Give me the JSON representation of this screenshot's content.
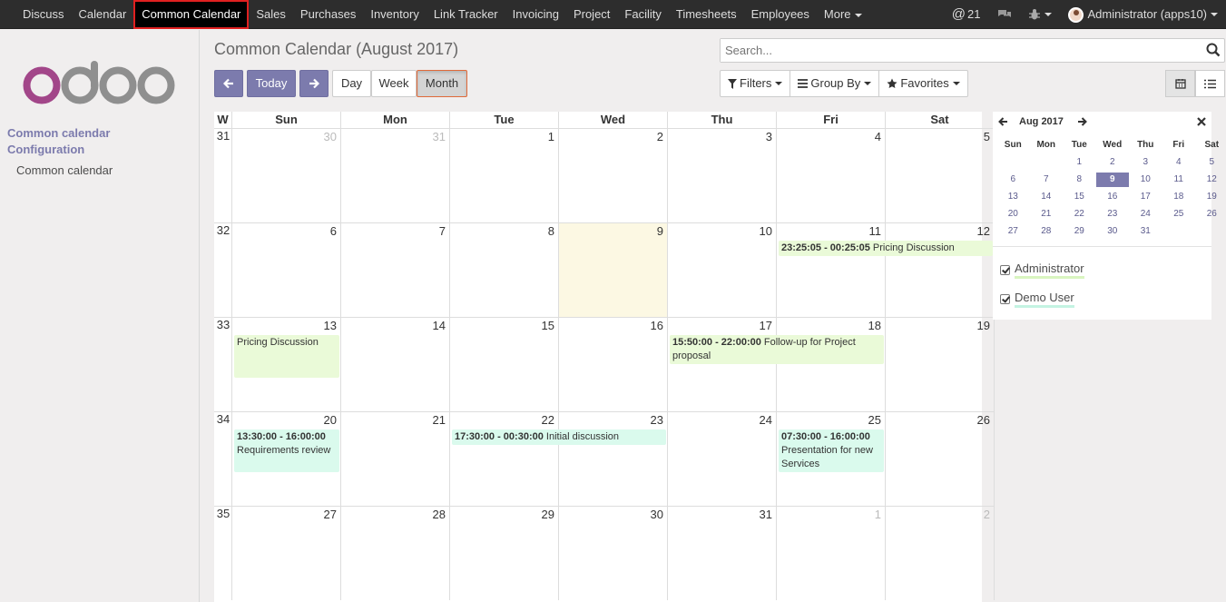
{
  "nav": {
    "menu": [
      "Discuss",
      "Calendar",
      "Common Calendar",
      "Sales",
      "Purchases",
      "Inventory",
      "Link Tracker",
      "Invoicing",
      "Project",
      "Facility",
      "Timesheets",
      "Employees",
      "More"
    ],
    "active": "Common Calendar",
    "mentions_count": "21",
    "user": "Administrator (apps10)"
  },
  "sidebar": {
    "section": "Common calendar Configuration",
    "items": [
      "Common calendar"
    ]
  },
  "header": {
    "title": "Common Calendar (August 2017)",
    "today_label": "Today",
    "views": [
      "Day",
      "Week",
      "Month"
    ],
    "active_view": "Month",
    "search_placeholder": "Search...",
    "filters_label": "Filters",
    "groupby_label": "Group By",
    "favorites_label": "Favorites"
  },
  "calendar": {
    "week_header": "W",
    "day_headers": [
      "Sun",
      "Mon",
      "Tue",
      "Wed",
      "Thu",
      "Fri",
      "Sat"
    ],
    "weeks": [
      {
        "num": "31",
        "days": [
          "30",
          "31",
          "1",
          "2",
          "3",
          "4",
          "5"
        ],
        "other": [
          true,
          true,
          false,
          false,
          false,
          false,
          false
        ]
      },
      {
        "num": "32",
        "days": [
          "6",
          "7",
          "8",
          "9",
          "10",
          "11",
          "12"
        ],
        "other": [
          false,
          false,
          false,
          false,
          false,
          false,
          false
        ]
      },
      {
        "num": "33",
        "days": [
          "13",
          "14",
          "15",
          "16",
          "17",
          "18",
          "19"
        ],
        "other": [
          false,
          false,
          false,
          false,
          false,
          false,
          false
        ]
      },
      {
        "num": "34",
        "days": [
          "20",
          "21",
          "22",
          "23",
          "24",
          "25",
          "26"
        ],
        "other": [
          false,
          false,
          false,
          false,
          false,
          false,
          false
        ]
      },
      {
        "num": "35",
        "days": [
          "27",
          "28",
          "29",
          "30",
          "31",
          "1",
          "2"
        ],
        "other": [
          false,
          false,
          false,
          false,
          false,
          true,
          true
        ]
      }
    ],
    "today": "9",
    "events": [
      {
        "time": "23:25:05 - 00:25:05",
        "title": "Pricing Discussion",
        "week": 1,
        "start": 5,
        "span": 2,
        "color": "green"
      },
      {
        "time": "",
        "title": "Pricing Discussion",
        "week": 2,
        "start": 0,
        "span": 1,
        "color": "green"
      },
      {
        "time": "15:50:00 - 22:00:00",
        "title": "Follow-up for Project proposal",
        "week": 2,
        "start": 4,
        "span": 2,
        "color": "green"
      },
      {
        "time": "13:30:00 - 16:00:00",
        "title": "Requirements review",
        "week": 3,
        "start": 0,
        "span": 1,
        "color": "teal"
      },
      {
        "time": "17:30:00 - 00:30:00",
        "title": "Initial discussion",
        "week": 3,
        "start": 2,
        "span": 2,
        "color": "teal"
      },
      {
        "time": "07:30:00 - 16:00:00",
        "title": "Presentation for new Services",
        "week": 3,
        "start": 5,
        "span": 1,
        "color": "teal"
      }
    ]
  },
  "mini_calendar": {
    "month_label": "Aug 2017",
    "headers": [
      "Sun",
      "Mon",
      "Tue",
      "Wed",
      "Thu",
      "Fri",
      "Sat"
    ],
    "rows": [
      [
        "",
        "",
        "1",
        "2",
        "3",
        "4",
        "5"
      ],
      [
        "6",
        "7",
        "8",
        "9",
        "10",
        "11",
        "12"
      ],
      [
        "13",
        "14",
        "15",
        "16",
        "17",
        "18",
        "19"
      ],
      [
        "20",
        "21",
        "22",
        "23",
        "24",
        "25",
        "26"
      ],
      [
        "27",
        "28",
        "29",
        "30",
        "31",
        "",
        ""
      ]
    ],
    "selected": "9"
  },
  "attendees": [
    {
      "name": "Administrator",
      "checked": true,
      "color": "#d9f5c0"
    },
    {
      "name": "Demo User",
      "checked": true,
      "color": "#c4f3e2"
    }
  ],
  "colors": {
    "primary": "#7c7bad",
    "today_bg": "#fcf8e3",
    "event_green": "#eafad8",
    "event_teal": "#dafaed"
  }
}
